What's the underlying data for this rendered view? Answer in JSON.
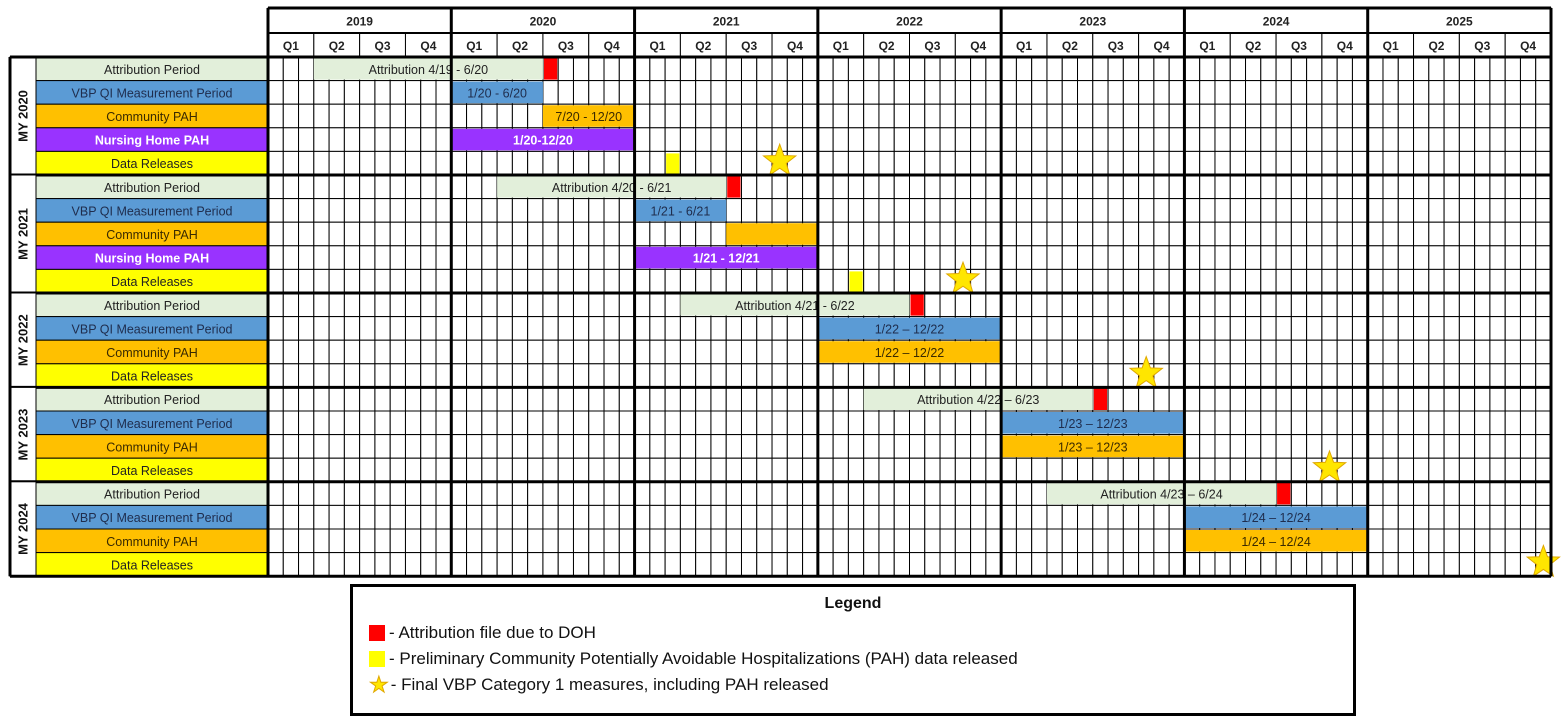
{
  "chart_data": {
    "type": "gantt",
    "title": "",
    "timeline": {
      "start": "2019-01",
      "end": "2025-12",
      "years": [
        "2019",
        "2020",
        "2021",
        "2022",
        "2023",
        "2024",
        "2025"
      ],
      "quarters": [
        "Q1",
        "Q2",
        "Q3",
        "Q4"
      ]
    },
    "row_types": {
      "attribution": {
        "label": "Attribution Period",
        "color": "#e2efda",
        "text_color": "#222222"
      },
      "vbp": {
        "label": "VBP QI Measurement Period",
        "color": "#5b9bd5",
        "text_color": "#1f2d4d"
      },
      "community": {
        "label": "Community PAH",
        "color": "#ffc000",
        "text_color": "#3a2a00"
      },
      "nursing": {
        "label": "Nursing Home PAH",
        "color": "#9933ff",
        "text_color": "#ffffff"
      },
      "releases": {
        "label": "Data Releases",
        "color": "#ffff00",
        "text_color": "#222222"
      }
    },
    "markers": {
      "attribution_due": {
        "color": "#ff0000"
      },
      "prelim_release": {
        "color": "#ffff00"
      },
      "final_release": {
        "color": "#ffe600"
      }
    },
    "groups": [
      {
        "name": "MY 2020",
        "rows": [
          {
            "type": "attribution",
            "bars": [
              {
                "start": "2019-04",
                "end": "2020-06",
                "text": "Attribution 4/19 - 6/20"
              }
            ],
            "markers": [
              {
                "kind": "attribution_due",
                "month": "2020-07"
              }
            ]
          },
          {
            "type": "vbp",
            "bars": [
              {
                "start": "2020-01",
                "end": "2020-06",
                "text": "1/20 - 6/20"
              }
            ]
          },
          {
            "type": "community",
            "bars": [
              {
                "start": "2020-07",
                "end": "2020-12",
                "text": "7/20 - 12/20"
              }
            ]
          },
          {
            "type": "nursing",
            "bars": [
              {
                "start": "2020-01",
                "end": "2020-12",
                "text": "1/20-12/20"
              }
            ]
          },
          {
            "type": "releases",
            "markers": [
              {
                "kind": "prelim_release",
                "month": "2021-03"
              },
              {
                "kind": "final_release",
                "month": "2021-10"
              }
            ]
          }
        ]
      },
      {
        "name": "MY 2021",
        "rows": [
          {
            "type": "attribution",
            "bars": [
              {
                "start": "2020-04",
                "end": "2021-06",
                "text": "Attribution 4/20 - 6/21"
              }
            ],
            "markers": [
              {
                "kind": "attribution_due",
                "month": "2021-07"
              }
            ]
          },
          {
            "type": "vbp",
            "bars": [
              {
                "start": "2021-01",
                "end": "2021-06",
                "text": "1/21 - 6/21"
              }
            ]
          },
          {
            "type": "community",
            "bars": [
              {
                "start": "2021-07",
                "end": "2021-12",
                "text": ""
              }
            ]
          },
          {
            "type": "nursing",
            "bars": [
              {
                "start": "2021-01",
                "end": "2021-12",
                "text": "1/21 - 12/21"
              }
            ]
          },
          {
            "type": "releases",
            "markers": [
              {
                "kind": "prelim_release",
                "month": "2022-03"
              },
              {
                "kind": "final_release",
                "month": "2022-10"
              }
            ]
          }
        ]
      },
      {
        "name": "MY 2022",
        "rows": [
          {
            "type": "attribution",
            "bars": [
              {
                "start": "2021-04",
                "end": "2022-06",
                "text": "Attribution 4/21 - 6/22"
              }
            ],
            "markers": [
              {
                "kind": "attribution_due",
                "month": "2022-07"
              }
            ]
          },
          {
            "type": "vbp",
            "bars": [
              {
                "start": "2022-01",
                "end": "2022-12",
                "text": "1/22 – 12/22"
              }
            ]
          },
          {
            "type": "community",
            "bars": [
              {
                "start": "2022-01",
                "end": "2022-12",
                "text": "1/22 – 12/22"
              }
            ]
          },
          {
            "type": "releases",
            "markers": [
              {
                "kind": "final_release",
                "month": "2023-10"
              }
            ]
          }
        ]
      },
      {
        "name": "MY 2023",
        "rows": [
          {
            "type": "attribution",
            "bars": [
              {
                "start": "2022-04",
                "end": "2023-06",
                "text": "Attribution 4/22 – 6/23"
              }
            ],
            "markers": [
              {
                "kind": "attribution_due",
                "month": "2023-07"
              }
            ]
          },
          {
            "type": "vbp",
            "bars": [
              {
                "start": "2023-01",
                "end": "2023-12",
                "text": "1/23 – 12/23"
              }
            ]
          },
          {
            "type": "community",
            "bars": [
              {
                "start": "2023-01",
                "end": "2023-12",
                "text": "1/23 – 12/23"
              }
            ]
          },
          {
            "type": "releases",
            "markers": [
              {
                "kind": "final_release",
                "month": "2024-10"
              }
            ]
          }
        ]
      },
      {
        "name": "MY 2024",
        "rows": [
          {
            "type": "attribution",
            "bars": [
              {
                "start": "2023-04",
                "end": "2024-06",
                "text": "Attribution 4/23 – 6/24"
              }
            ],
            "markers": [
              {
                "kind": "attribution_due",
                "month": "2024-07"
              }
            ]
          },
          {
            "type": "vbp",
            "bars": [
              {
                "start": "2024-01",
                "end": "2024-12",
                "text": "1/24 – 12/24"
              }
            ]
          },
          {
            "type": "community",
            "bars": [
              {
                "start": "2024-01",
                "end": "2024-12",
                "text": "1/24 – 12/24"
              }
            ]
          },
          {
            "type": "releases",
            "markers": [
              {
                "kind": "final_release",
                "month": "2025-12"
              }
            ]
          }
        ]
      }
    ],
    "legend": {
      "title": "Legend",
      "position": "bottom-center",
      "entries": [
        {
          "symbol": "red-square",
          "text": "- Attribution file due to DOH"
        },
        {
          "symbol": "yellow-square",
          "text": "-  Preliminary Community Potentially Avoidable Hospitalizations (PAH) data released"
        },
        {
          "symbol": "yellow-star",
          "text": "- Final VBP Category 1 measures, including PAH released"
        }
      ]
    }
  }
}
